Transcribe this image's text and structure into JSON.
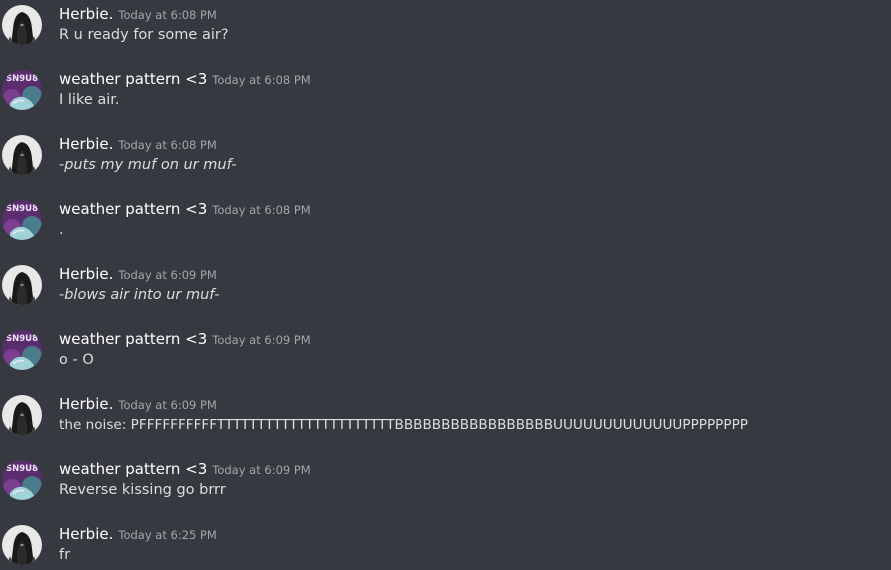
{
  "colors": {
    "background": "#36393f",
    "author": "#ffffff",
    "timestamp": "#a3a6aa",
    "text": "#dcddde"
  },
  "users": {
    "herbie": {
      "name": "Herbie.",
      "avatar_icon": "dark-hooded-figure-avatar-icon"
    },
    "weather": {
      "name": "weather pattern <3",
      "avatar_icon": "purple-sneakers-avatar-icon",
      "avatar_text": "SN9U8"
    }
  },
  "messages": [
    {
      "user": "herbie",
      "author": "Herbie.",
      "timestamp": "Today at 6:08 PM",
      "text": "R u ready for some air?",
      "italic": false
    },
    {
      "user": "weather",
      "author": "weather pattern <3",
      "timestamp": "Today at 6:08 PM",
      "text": "I like air.",
      "italic": false
    },
    {
      "user": "herbie",
      "author": "Herbie.",
      "timestamp": "Today at 6:08 PM",
      "text": "-puts my muf on ur muf-",
      "italic": true
    },
    {
      "user": "weather",
      "author": "weather pattern <3",
      "timestamp": "Today at 6:08 PM",
      "text": ".",
      "italic": false
    },
    {
      "user": "herbie",
      "author": "Herbie.",
      "timestamp": "Today at 6:09 PM",
      "text": "-blows air into ur muf-",
      "italic": true
    },
    {
      "user": "weather",
      "author": "weather pattern <3",
      "timestamp": "Today at 6:09 PM",
      "text": "o - O",
      "italic": false
    },
    {
      "user": "herbie",
      "author": "Herbie.",
      "timestamp": "Today at 6:09 PM",
      "text": "the noise: PFFFFFFFFFFTTTTTTTTTTTTTTTTTTTTTTBBBBBBBBBBBBBBBBBUUUUUUUUUUUUUPPPPPPPP",
      "italic": false
    },
    {
      "user": "weather",
      "author": "weather pattern <3",
      "timestamp": "Today at 6:09 PM",
      "text": "Reverse kissing go brrr",
      "italic": false
    },
    {
      "user": "herbie",
      "author": "Herbie.",
      "timestamp": "Today at 6:25 PM",
      "text": "fr",
      "italic": false
    }
  ]
}
